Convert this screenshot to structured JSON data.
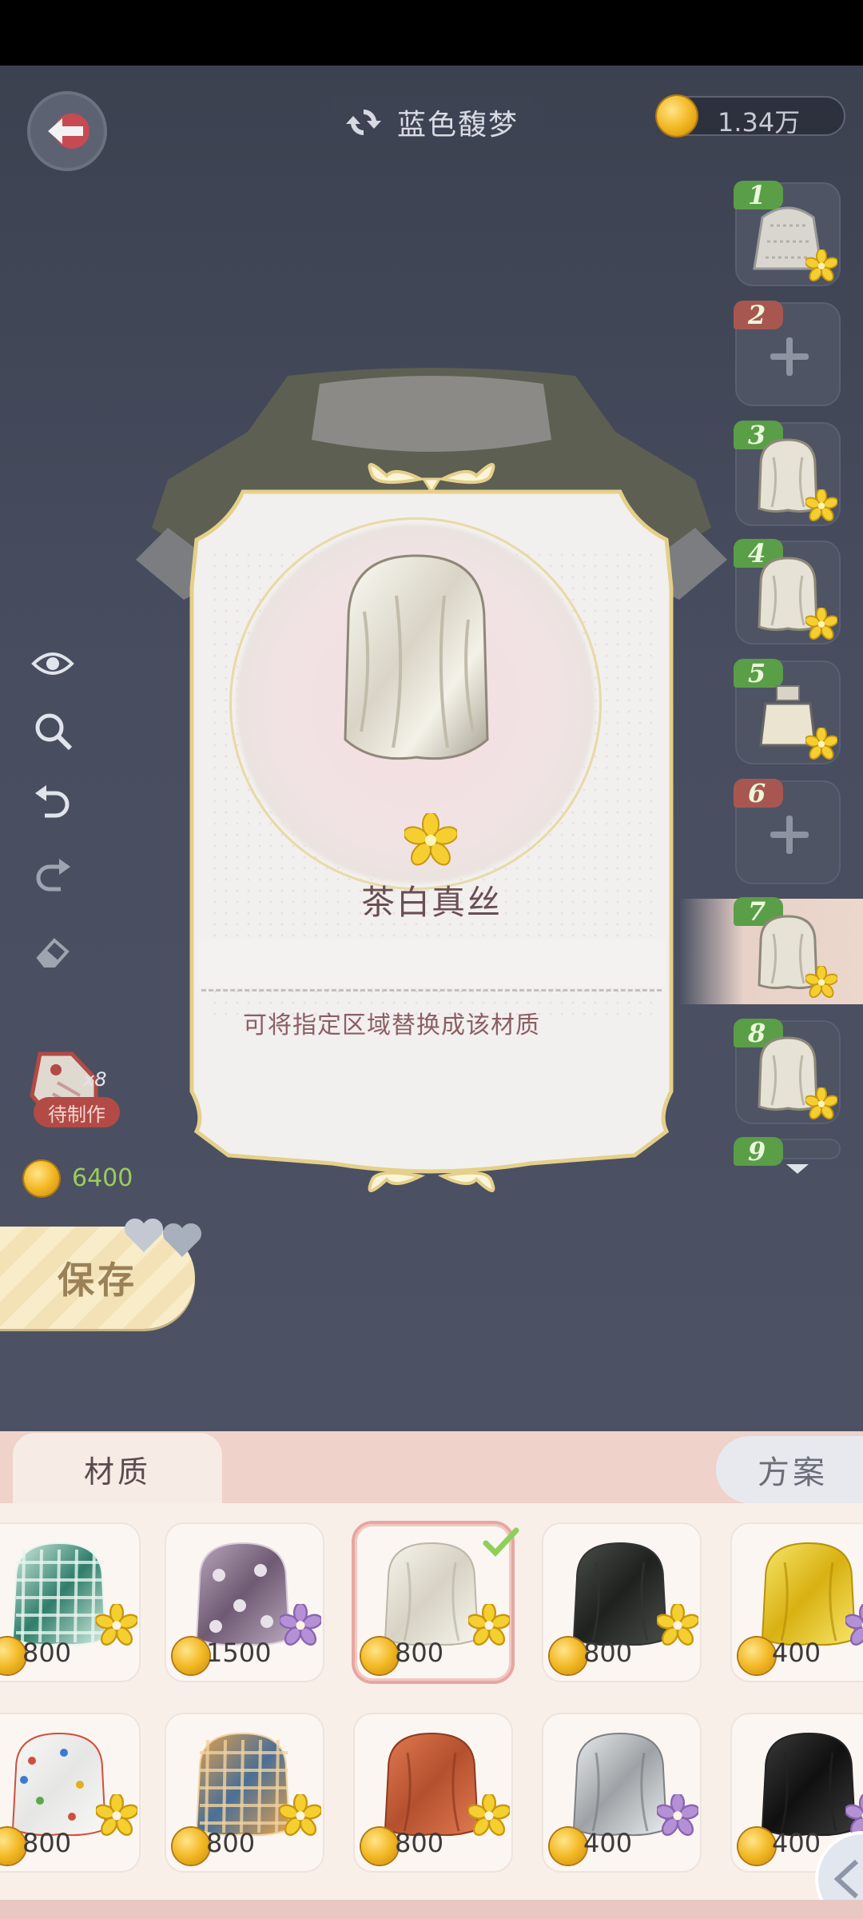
{
  "header": {
    "title": "蓝色馥梦",
    "currency_amount": "1.34万"
  },
  "layers": {
    "slots": [
      {
        "num": "1",
        "state": "filled",
        "tag_color": "#5a9e48"
      },
      {
        "num": "2",
        "state": "empty",
        "tag_color": "#a85750"
      },
      {
        "num": "3",
        "state": "filled",
        "tag_color": "#5a9e48"
      },
      {
        "num": "4",
        "state": "filled",
        "tag_color": "#5a9e48"
      },
      {
        "num": "5",
        "state": "filled",
        "tag_color": "#5a9e48"
      },
      {
        "num": "6",
        "state": "empty",
        "tag_color": "#a85750"
      },
      {
        "num": "7",
        "state": "selected",
        "tag_color": "#5a9e48"
      },
      {
        "num": "8",
        "state": "filled",
        "tag_color": "#5a9e48"
      },
      {
        "num": "9",
        "state": "partial",
        "tag_color": "#5a9e48"
      }
    ]
  },
  "left_panel": {
    "pending_count": "x8",
    "pending_label": "待制作",
    "cost": "6400",
    "save_label": "保存"
  },
  "card": {
    "title": "茶白真丝",
    "description": "可将指定区域替换成该材质"
  },
  "tabs": {
    "material": "材质",
    "plan": "方案"
  },
  "materials": [
    {
      "price": "800",
      "pattern": "green-plaid",
      "flower": "gold"
    },
    {
      "price": "1500",
      "pattern": "purple-floral",
      "flower": "purple"
    },
    {
      "price": "800",
      "pattern": "ivory-silk",
      "flower": "gold",
      "selected": true
    },
    {
      "price": "800",
      "pattern": "black-satin",
      "flower": "gold"
    },
    {
      "price": "400",
      "pattern": "gold-satin",
      "flower": "purple"
    },
    {
      "price": "800",
      "pattern": "polka-dot",
      "flower": "gold"
    },
    {
      "price": "800",
      "pattern": "blue-plaid",
      "flower": "gold"
    },
    {
      "price": "800",
      "pattern": "rust-satin",
      "flower": "gold"
    },
    {
      "price": "400",
      "pattern": "silver-satin",
      "flower": "purple"
    },
    {
      "price": "400",
      "pattern": "black-velvet",
      "flower": "purple"
    }
  ],
  "colors": {
    "accent_gold": "#e8d28f",
    "selected_border": "#e6a7a0",
    "cost_green": "#9ccc5a"
  }
}
